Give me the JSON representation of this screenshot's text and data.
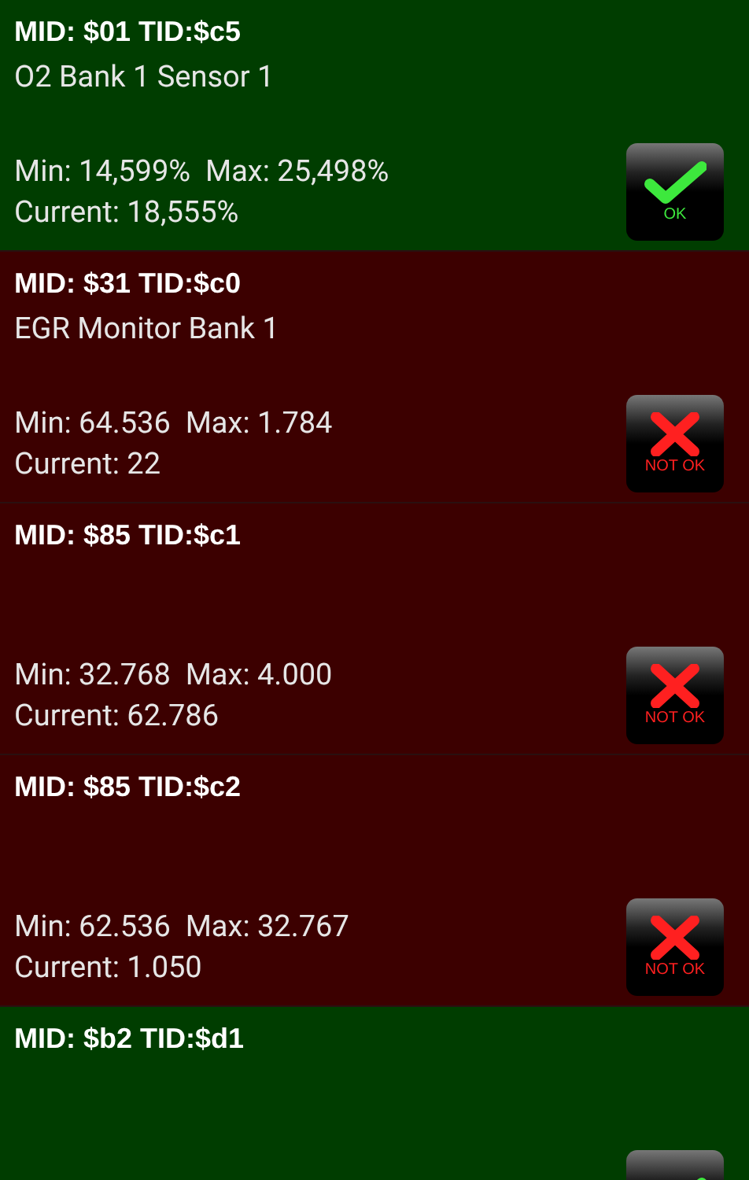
{
  "results": [
    {
      "title": "MID: $01 TID:$c5",
      "name": "O2 Bank 1 Sensor 1",
      "range": "Min: 14,599%  Max: 25,498%",
      "current": "Current: 18,555%",
      "ok": true,
      "badge": "OK"
    },
    {
      "title": "MID: $31 TID:$c0",
      "name": "EGR Monitor Bank 1",
      "range": "Min: 64.536  Max: 1.784",
      "current": "Current: 22",
      "ok": false,
      "badge": "NOT OK"
    },
    {
      "title": "MID: $85 TID:$c1",
      "range": "Min: 32.768  Max: 4.000",
      "current": "Current: 62.786",
      "ok": false,
      "badge": "NOT OK"
    },
    {
      "title": "MID: $85 TID:$c2",
      "range": "Min: 62.536  Max: 32.767",
      "current": "Current: 1.050",
      "ok": false,
      "badge": "NOT OK"
    },
    {
      "title": "MID: $b2 TID:$d1",
      "ok": true
    }
  ]
}
